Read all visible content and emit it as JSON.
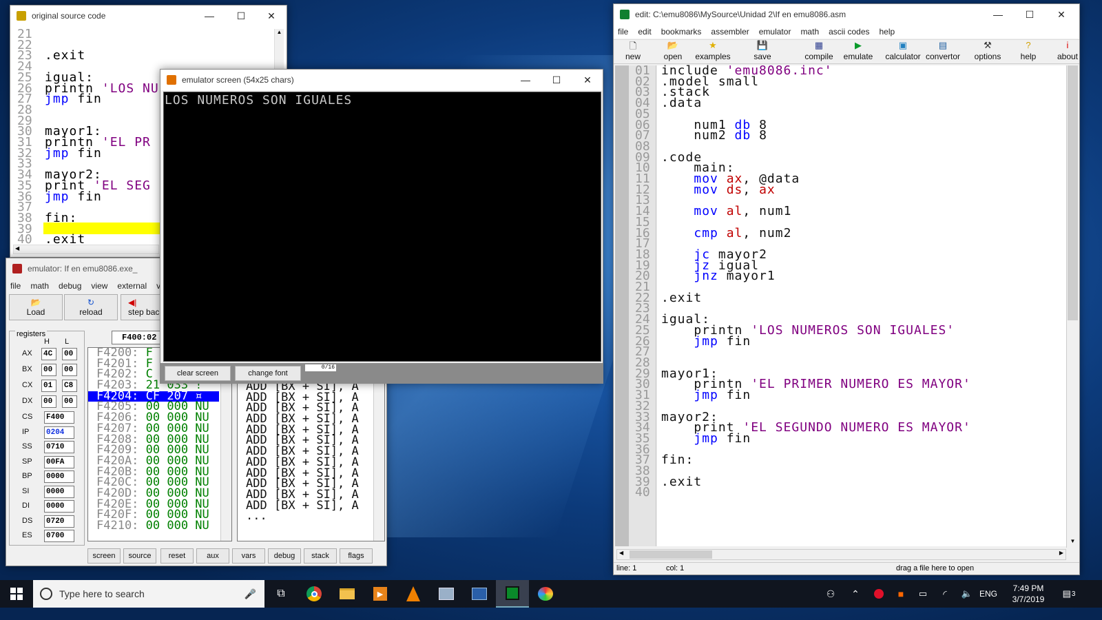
{
  "src_window": {
    "title": "original source code",
    "gutter": [
      "21",
      "22",
      "23",
      "24",
      "25",
      "26",
      "27",
      "28",
      "29",
      "30",
      "31",
      "32",
      "33",
      "34",
      "35",
      "36",
      "37",
      "38",
      "39",
      "40"
    ]
  },
  "emu_screen": {
    "title": "emulator screen (54x25 chars)",
    "output": "LOS NUMEROS SON IGUALES",
    "clear_label": "clear screen",
    "font_label": "change font",
    "counter": "0/16"
  },
  "emulator": {
    "title": "emulator: If en emu8086.exe_",
    "menu": [
      "file",
      "math",
      "debug",
      "view",
      "external",
      "vi"
    ],
    "tools": [
      "Load",
      "reload",
      "step bac"
    ],
    "address": "F400:02",
    "registers_label": "registers",
    "h": "H",
    "l": "L",
    "regs": [
      {
        "n": "AX",
        "h": "4C",
        "l": "00"
      },
      {
        "n": "BX",
        "h": "00",
        "l": "00"
      },
      {
        "n": "CX",
        "h": "01",
        "l": "C8"
      },
      {
        "n": "DX",
        "h": "00",
        "l": "00"
      }
    ],
    "segs": [
      {
        "n": "CS",
        "v": "F400"
      },
      {
        "n": "IP",
        "v": "0204"
      },
      {
        "n": "SS",
        "v": "0710"
      },
      {
        "n": "SP",
        "v": "00FA"
      },
      {
        "n": "BP",
        "v": "0000"
      },
      {
        "n": "SI",
        "v": "0000"
      },
      {
        "n": "DI",
        "v": "0000"
      },
      {
        "n": "DS",
        "v": "0720"
      },
      {
        "n": "ES",
        "v": "0700"
      }
    ],
    "mem": [
      {
        "a": "F4200:",
        "b": "F"
      },
      {
        "a": "F4201:",
        "b": "F"
      },
      {
        "a": "F4202:",
        "b": "C"
      },
      {
        "a": "F4203:",
        "b": "21 033 !"
      },
      {
        "a": "F4204:",
        "b": "CF 207 ¤"
      },
      {
        "a": "F4205:",
        "b": "00 000 NU"
      },
      {
        "a": "F4206:",
        "b": "00 000 NU"
      },
      {
        "a": "F4207:",
        "b": "00 000 NU"
      },
      {
        "a": "F4208:",
        "b": "00 000 NU"
      },
      {
        "a": "F4209:",
        "b": "00 000 NU"
      },
      {
        "a": "F420A:",
        "b": "00 000 NU"
      },
      {
        "a": "F420B:",
        "b": "00 000 NU"
      },
      {
        "a": "F420C:",
        "b": "00 000 NU"
      },
      {
        "a": "F420D:",
        "b": "00 000 NU"
      },
      {
        "a": "F420E:",
        "b": "00 000 NU"
      },
      {
        "a": "F420F:",
        "b": "00 000 NU"
      },
      {
        "a": "F4210:",
        "b": "00 000 NU"
      }
    ],
    "disasm": [
      "ADD [BX + SI], A",
      "ADD [BX + SI], A",
      "ADD [BX + SI], A",
      "ADD [BX + SI], A",
      "ADD [BX + SI], A",
      "ADD [BX + SI], A",
      "ADD [BX + SI], A",
      "ADD [BX + SI], A",
      "ADD [BX + SI], A",
      "ADD [BX + SI], A",
      "ADD [BX + SI], A",
      "ADD [BX + SI], A",
      "..."
    ],
    "bottom": [
      "screen",
      "source",
      "reset",
      "aux",
      "vars",
      "debug",
      "stack",
      "flags"
    ]
  },
  "editor": {
    "title": "edit: C:\\emu8086\\MySource\\Unidad 2\\If en emu8086.asm",
    "menu": [
      "file",
      "edit",
      "bookmarks",
      "assembler",
      "emulator",
      "math",
      "ascii codes",
      "help"
    ],
    "tools": [
      "new",
      "open",
      "examples",
      "save",
      "compile",
      "emulate",
      "calculator",
      "convertor",
      "options",
      "help",
      "about"
    ],
    "gutter": [
      "01",
      "02",
      "03",
      "04",
      "05",
      "06",
      "07",
      "08",
      "09",
      "10",
      "11",
      "12",
      "13",
      "14",
      "15",
      "16",
      "17",
      "18",
      "19",
      "20",
      "21",
      "22",
      "23",
      "24",
      "25",
      "26",
      "27",
      "28",
      "29",
      "30",
      "31",
      "32",
      "33",
      "34",
      "35",
      "36",
      "37",
      "38",
      "39",
      "40"
    ],
    "status_line": "line: 1",
    "status_col": "col: 1",
    "status_drag": "drag a file here to open"
  },
  "taskbar": {
    "search": "Type here to search",
    "lang": "ENG",
    "time": "7:49 PM",
    "date": "3/7/2019",
    "notif": "3"
  }
}
